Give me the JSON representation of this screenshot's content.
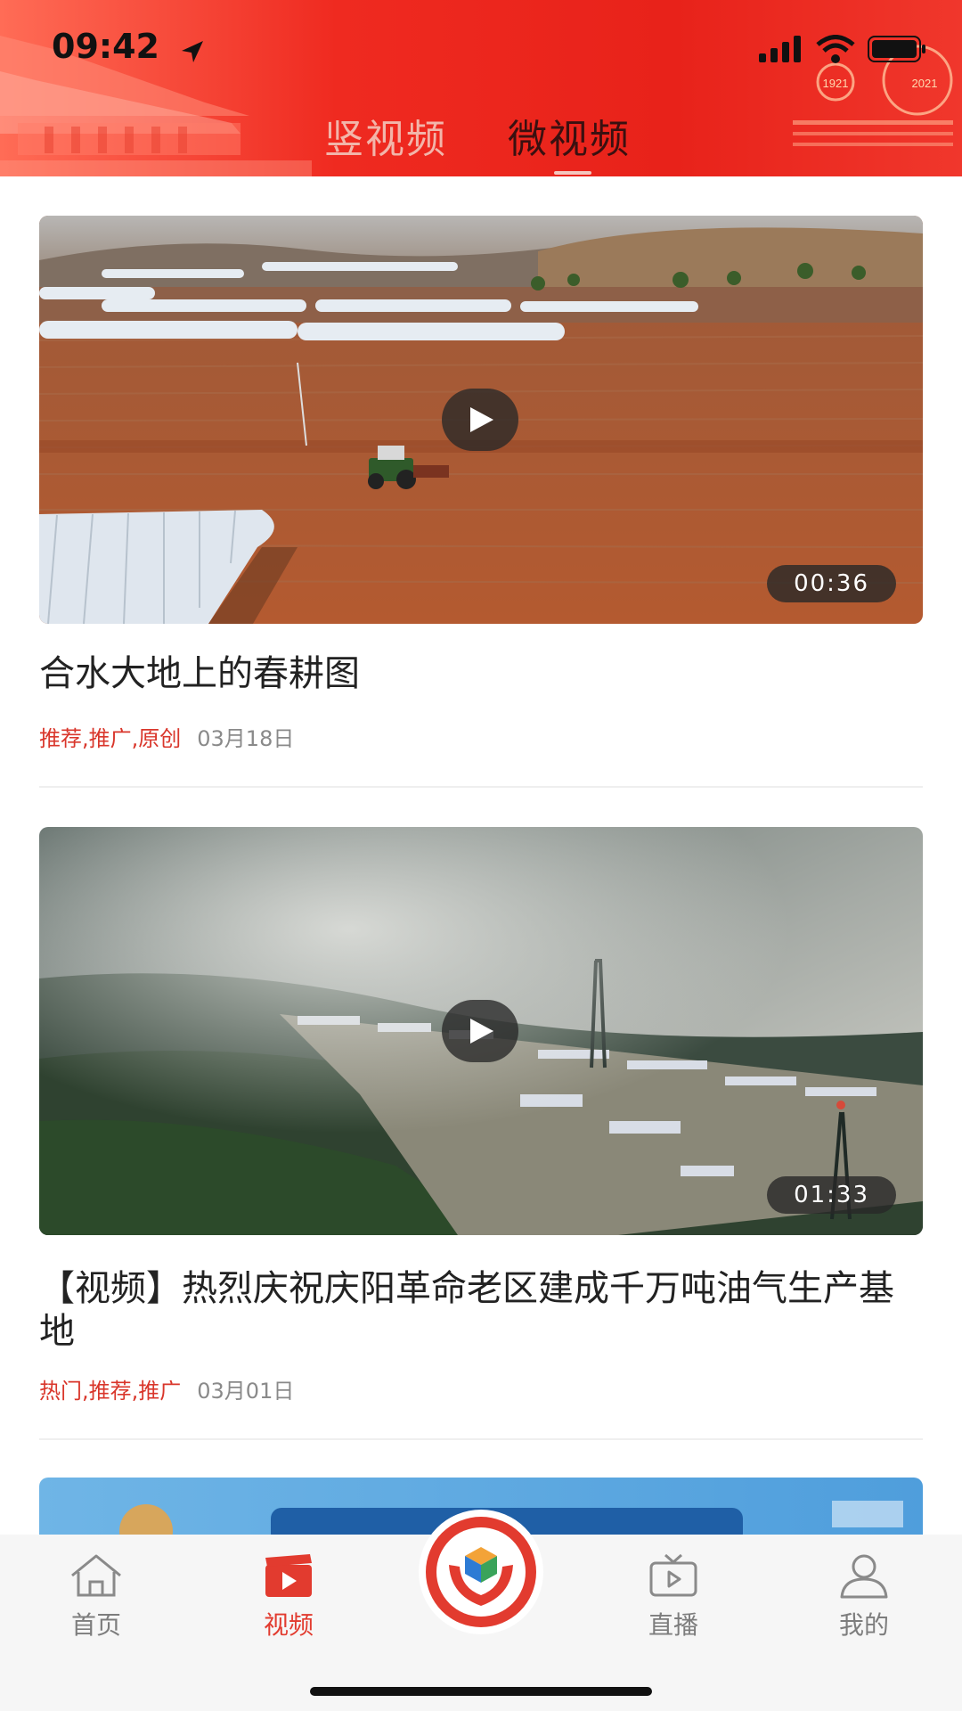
{
  "status_bar": {
    "time": "09:42"
  },
  "top_tabs": [
    {
      "label": "竖视频",
      "active": false
    },
    {
      "label": "微视频",
      "active": true
    }
  ],
  "videos": [
    {
      "title": "合水大地上的春耕图",
      "tags": "推荐,推广,原创",
      "date": "03月18日",
      "duration": "00:36"
    },
    {
      "title": "【视频】热烈庆祝庆阳革命老区建成千万吨油气生产基地",
      "tags": "热门,推荐,推广",
      "date": "03月01日",
      "duration": "01:33"
    }
  ],
  "bottom_nav": [
    {
      "label": "首页",
      "icon": "home-icon",
      "active": false
    },
    {
      "label": "视频",
      "icon": "video-icon",
      "active": true
    },
    {
      "label": "",
      "icon": "center-logo-icon",
      "active": false
    },
    {
      "label": "直播",
      "icon": "tv-icon",
      "active": false
    },
    {
      "label": "我的",
      "icon": "user-icon",
      "active": false
    }
  ],
  "colors": {
    "accent": "#e23b2f",
    "header_red": "#e8221a"
  }
}
